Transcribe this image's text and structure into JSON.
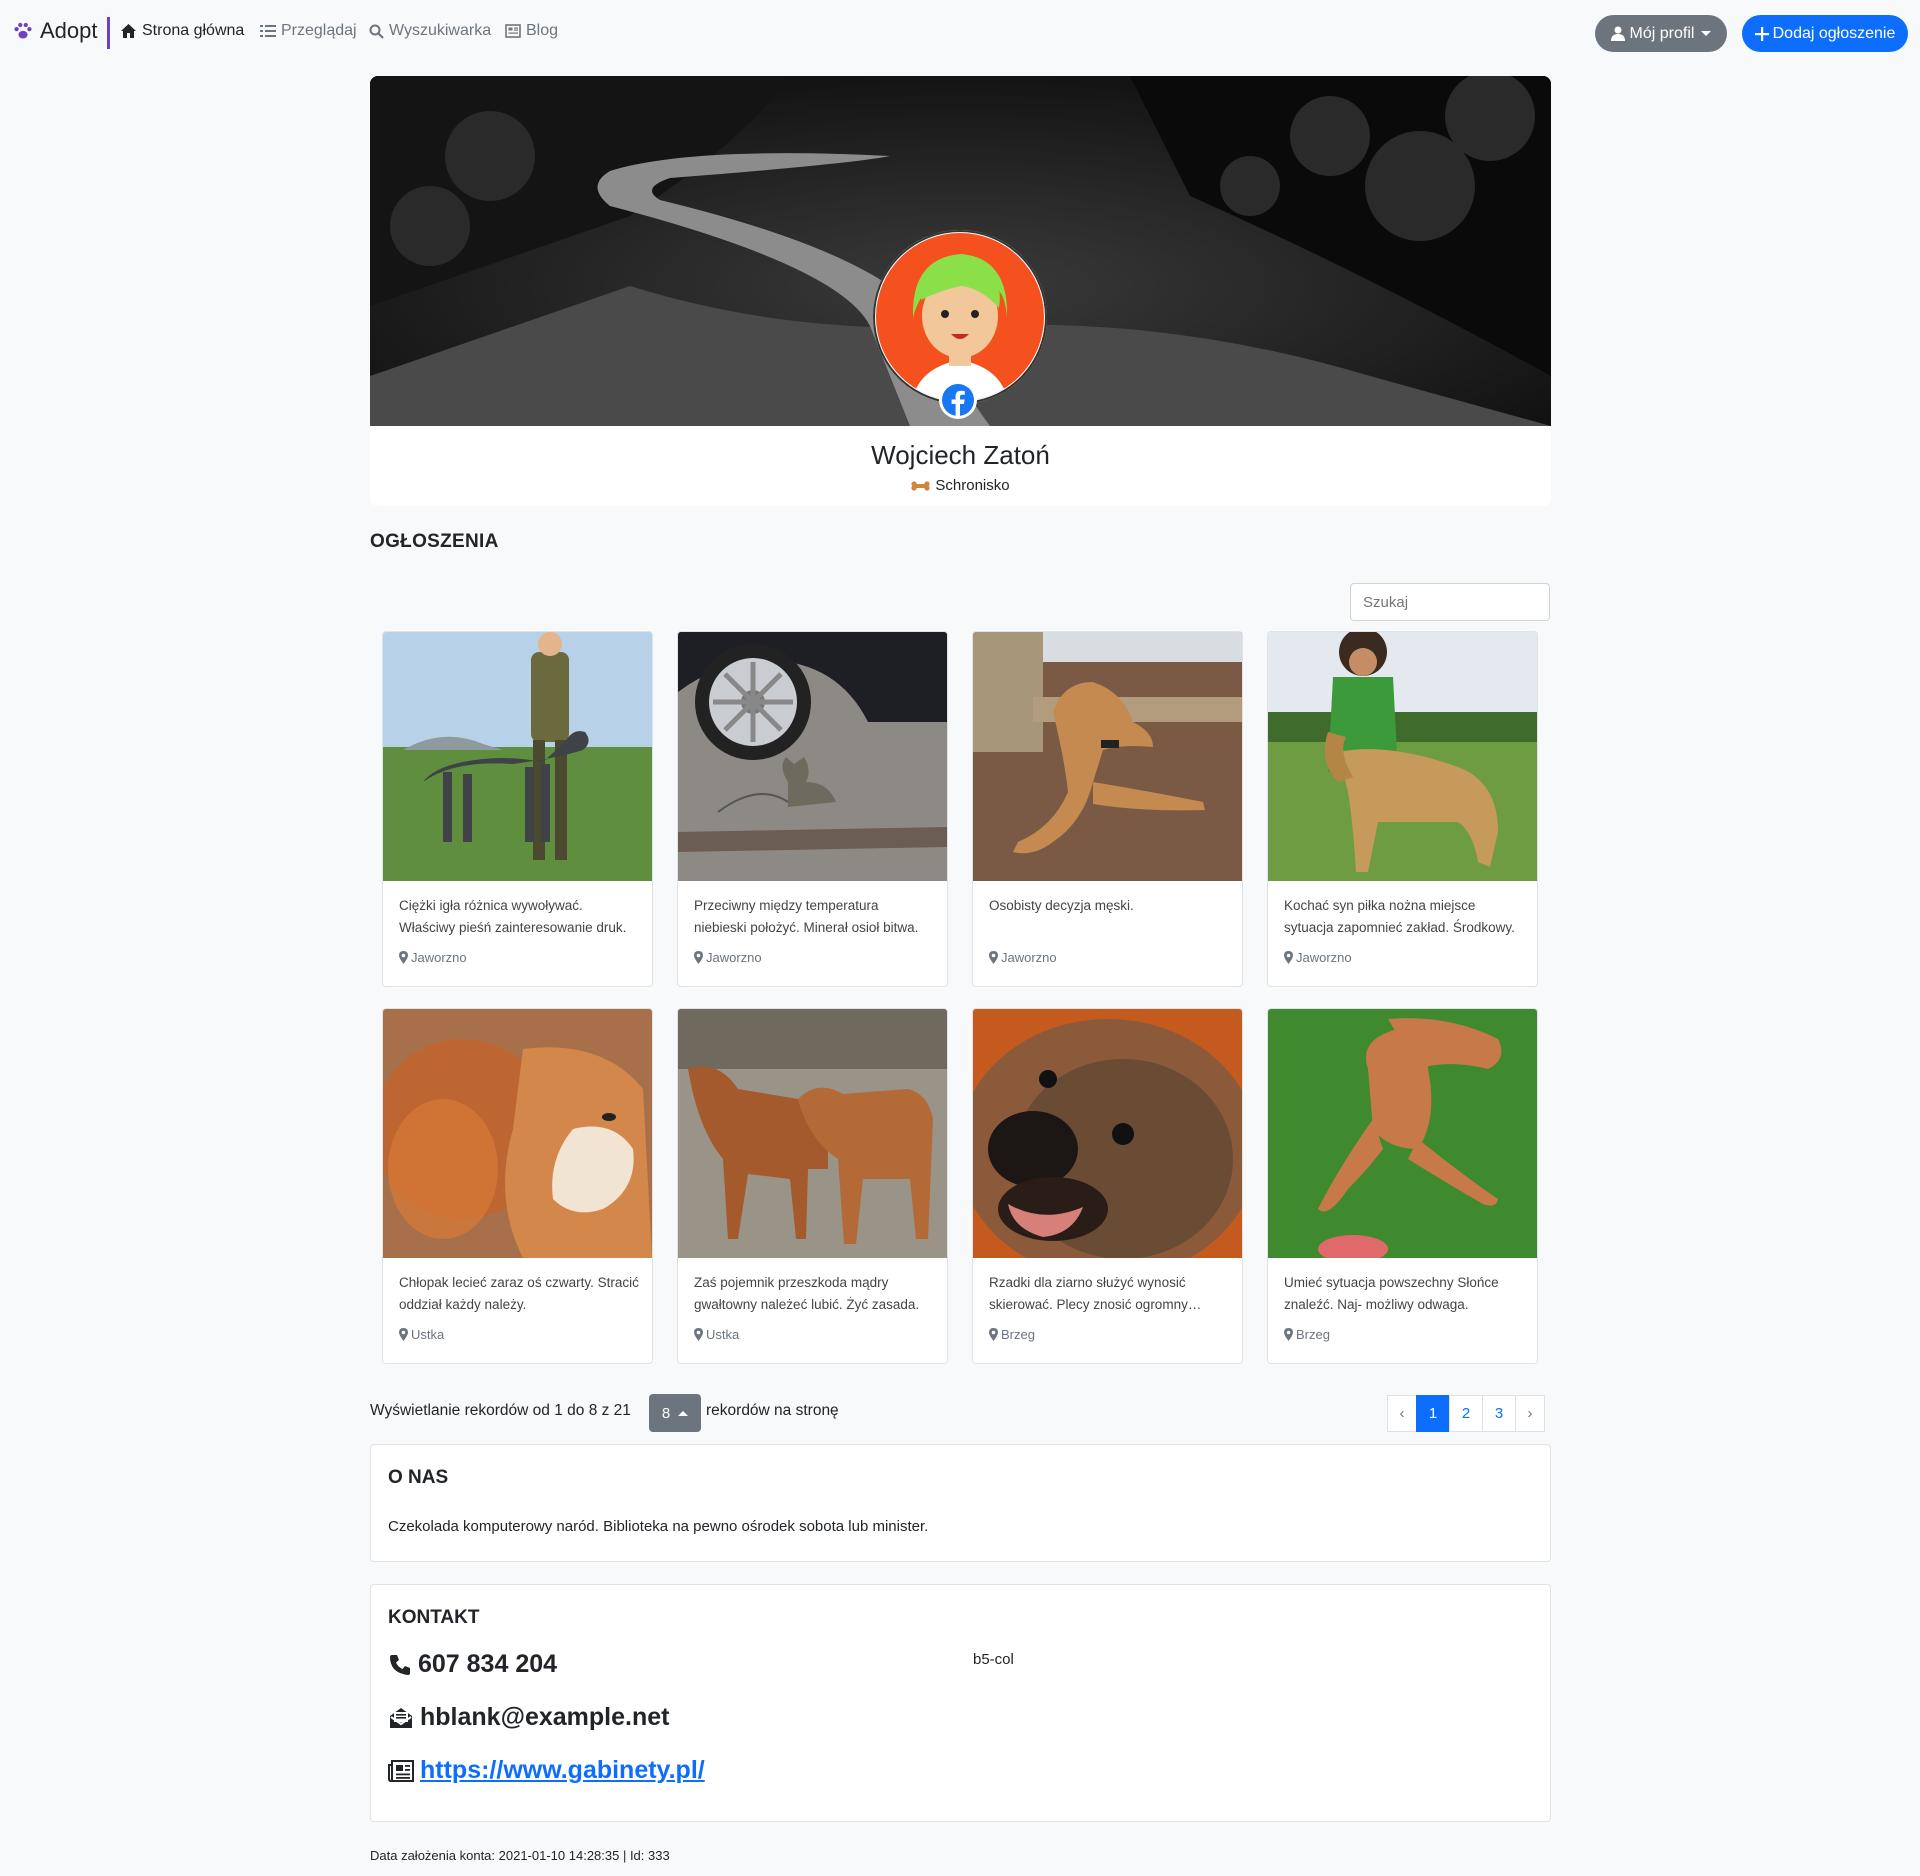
{
  "nav": {
    "brand": "Adopt",
    "links": [
      {
        "label": "Strona główna",
        "icon": "home-icon"
      },
      {
        "label": "Przeglądaj",
        "icon": "list-icon"
      },
      {
        "label": "Wyszukiwarka",
        "icon": "search-icon"
      },
      {
        "label": "Blog",
        "icon": "newspaper-icon"
      }
    ],
    "profile_label": "Mój profil",
    "add_label": "Dodaj ogłoszenie"
  },
  "profile": {
    "name": "Wojciech Zatoń",
    "type": "Schronisko"
  },
  "listings": {
    "heading": "OGŁOSZENIA",
    "search_placeholder": "Szukaj",
    "items": [
      {
        "desc": "Ciężki igła różnica wywoływać. Właściwy pieśń zainteresowanie druk.",
        "location": "Jaworzno",
        "image": "dog-with-person"
      },
      {
        "desc": "Przeciwny między temperatura niebieski położyć. Minerał osioł bitwa.",
        "location": "Jaworzno",
        "image": "cat-by-car"
      },
      {
        "desc": "Osobisty decyzja męski.",
        "location": "Jaworzno",
        "image": "dog-lying"
      },
      {
        "desc": "Kochać syn piłka nożna miejsce sytuacja zapomnieć zakład. Środkowy.",
        "location": "Jaworzno",
        "image": "afghan-hound"
      },
      {
        "desc": "Chłopak lecieć zaraz oś czwarty. Stracić oddział każdy należy.",
        "location": "Ustka",
        "image": "shiba"
      },
      {
        "desc": "Zaś pojemnik przeszkoda mądry gwałtowny należeć lubić. Żyć zasada.",
        "location": "Ustka",
        "image": "two-dogs"
      },
      {
        "desc": "Rzadki dla ziarno służyć wynosić skierować. Plecy znosić ogromny użytek.",
        "location": "Brzeg",
        "image": "dog-closeup"
      },
      {
        "desc": "Umieć sytuacja powszechny Słońce znaleźć. Naj- możliwy odwaga.",
        "location": "Brzeg",
        "image": "vizsla"
      }
    ]
  },
  "pagination": {
    "text_before": "Wyświetlanie rekordów od 1 do 8 z 21",
    "per_page": "8",
    "text_after": "rekordów na stronę",
    "prev": "‹",
    "next": "›",
    "pages": [
      "1",
      "2",
      "3"
    ]
  },
  "about": {
    "heading": "O NAS",
    "text": "Czekolada komputerowy naród. Biblioteka na pewno ośrodek sobota lub minister."
  },
  "contact": {
    "heading": "KONTAKT",
    "phone": "607 834 204",
    "email": "hblank@example.net",
    "website": "https://www.gabinety.pl/",
    "side_note": "b5-col"
  },
  "footer": {
    "text": "Data założenia konta: 2021-01-10 14:28:35 | Id: 333"
  },
  "colors": {
    "primary": "#0d6efd",
    "secondary": "#6c757d",
    "accent": "#6f42c1"
  }
}
